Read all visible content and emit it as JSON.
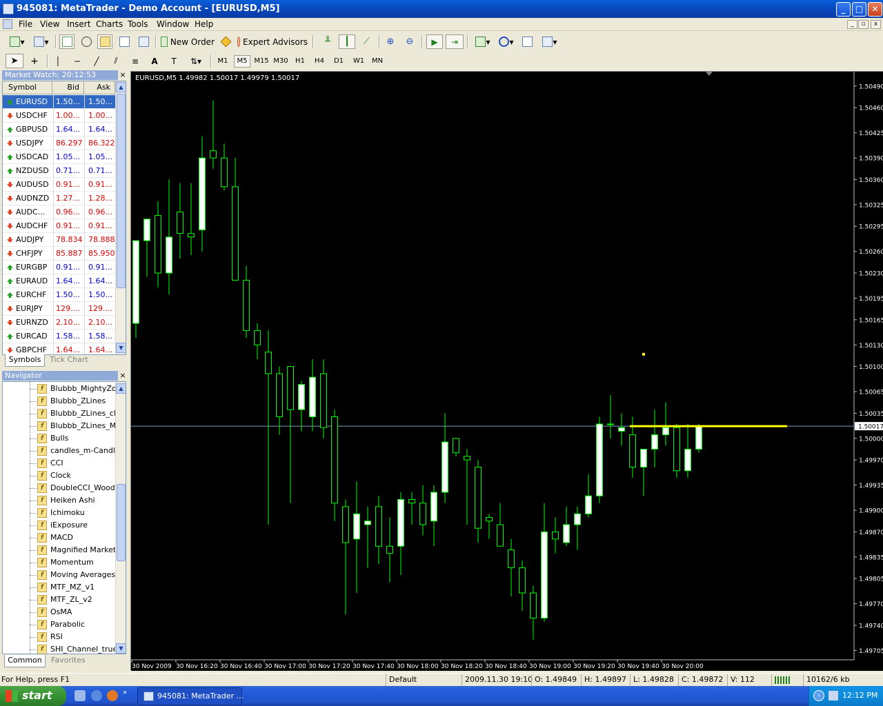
{
  "window": {
    "title": "945081: MetaTrader - Demo Account - [EURUSD,M5]"
  },
  "menu": [
    "File",
    "View",
    "Insert",
    "Charts",
    "Tools",
    "Window",
    "Help"
  ],
  "toolbar": {
    "new_order": "New Order",
    "expert_advisors": "Expert Advisors"
  },
  "timeframes": [
    "M1",
    "M5",
    "M15",
    "M30",
    "H1",
    "H4",
    "D1",
    "W1",
    "MN"
  ],
  "active_timeframe": "M5",
  "market_watch": {
    "title": "Market Watch: 20:12:53",
    "headers": {
      "symbol": "Symbol",
      "bid": "Bid",
      "ask": "Ask"
    },
    "rows": [
      {
        "symbol": "EURUSD",
        "bid": "1.50...",
        "ask": "1.50...",
        "dir": "up",
        "color": "#0000c8",
        "selected": true
      },
      {
        "symbol": "USDCHF",
        "bid": "1.00...",
        "ask": "1.00...",
        "dir": "down",
        "color": "#d80000"
      },
      {
        "symbol": "GBPUSD",
        "bid": "1.64...",
        "ask": "1.64...",
        "dir": "up",
        "color": "#0000c8"
      },
      {
        "symbol": "USDJPY",
        "bid": "86.297",
        "ask": "86.322",
        "dir": "down",
        "color": "#d80000"
      },
      {
        "symbol": "USDCAD",
        "bid": "1.05...",
        "ask": "1.05...",
        "dir": "up",
        "color": "#0000c8"
      },
      {
        "symbol": "NZDUSD",
        "bid": "0.71...",
        "ask": "0.71...",
        "dir": "up",
        "color": "#0000c8"
      },
      {
        "symbol": "AUDUSD",
        "bid": "0.91...",
        "ask": "0.91...",
        "dir": "down",
        "color": "#d80000"
      },
      {
        "symbol": "AUDNZD",
        "bid": "1.27...",
        "ask": "1.28...",
        "dir": "down",
        "color": "#d80000"
      },
      {
        "symbol": "AUDC...",
        "bid": "0.96...",
        "ask": "0.96...",
        "dir": "down",
        "color": "#d80000"
      },
      {
        "symbol": "AUDCHF",
        "bid": "0.91...",
        "ask": "0.91...",
        "dir": "down",
        "color": "#d80000"
      },
      {
        "symbol": "AUDJPY",
        "bid": "78.834",
        "ask": "78.888",
        "dir": "down",
        "color": "#d80000"
      },
      {
        "symbol": "CHFJPY",
        "bid": "85.887",
        "ask": "85.950",
        "dir": "down",
        "color": "#d80000"
      },
      {
        "symbol": "EURGBP",
        "bid": "0.91...",
        "ask": "0.91...",
        "dir": "up",
        "color": "#0000c8"
      },
      {
        "symbol": "EURAUD",
        "bid": "1.64...",
        "ask": "1.64...",
        "dir": "up",
        "color": "#0000c8"
      },
      {
        "symbol": "EURCHF",
        "bid": "1.50...",
        "ask": "1.50...",
        "dir": "up",
        "color": "#0000c8"
      },
      {
        "symbol": "EURJPY",
        "bid": "129....",
        "ask": "129....",
        "dir": "down",
        "color": "#d80000"
      },
      {
        "symbol": "EURNZD",
        "bid": "2.10...",
        "ask": "2.10...",
        "dir": "down",
        "color": "#d80000"
      },
      {
        "symbol": "EURCAD",
        "bid": "1.58...",
        "ask": "1.58...",
        "dir": "up",
        "color": "#0000c8"
      },
      {
        "symbol": "GBPCHF",
        "bid": "1.64...",
        "ask": "1.64...",
        "dir": "down",
        "color": "#d80000"
      }
    ],
    "tabs": [
      "Symbols",
      "Tick Chart"
    ]
  },
  "navigator": {
    "title": "Navigator",
    "items": [
      "Blubbb_MightyZone",
      "Blubbb_ZLines",
      "Blubbb_ZLines_close",
      "Blubbb_ZLines_MZ_",
      "Bulls",
      "candles_m-Candles_",
      "CCI",
      "Clock",
      "DoubleCCI_Woodie",
      "Heiken Ashi",
      "Ichimoku",
      "iExposure",
      "MACD",
      "Magnified Market Pr",
      "Momentum",
      "Moving Averages",
      "MTF_MZ_v1",
      "MTF_ZL_v2",
      "OsMA",
      "Parabolic",
      "RSI",
      "SHI_Channel_true"
    ],
    "tabs": [
      "Common",
      "Favorites"
    ]
  },
  "chart_data": {
    "type": "candlestick",
    "header": "EURUSD,M5  1.49982 1.50017 1.49979 1.50017",
    "ylim": [
      1.49692,
      1.5051
    ],
    "y_ticks": [
      "1.50490",
      "1.50460",
      "1.50425",
      "1.50390",
      "1.50360",
      "1.50325",
      "1.50295",
      "1.50260",
      "1.50230",
      "1.50195",
      "1.50165",
      "1.50130",
      "1.50100",
      "1.50065",
      "1.50035",
      "1.50000",
      "1.49970",
      "1.49935",
      "1.49900",
      "1.49870",
      "1.49835",
      "1.49805",
      "1.49770",
      "1.49740",
      "1.49705"
    ],
    "current_price": "1.50017",
    "x_labels": [
      "30 Nov 2009",
      "30 Nov 16:20",
      "30 Nov 16:40",
      "30 Nov 17:00",
      "30 Nov 17:20",
      "30 Nov 17:40",
      "30 Nov 18:00",
      "30 Nov 18:20",
      "30 Nov 18:40",
      "30 Nov 19:00",
      "30 Nov 19:20",
      "30 Nov 19:40",
      "30 Nov 20:00"
    ],
    "bar_seconds": 300,
    "colors": {
      "background": "#000000",
      "wick": "#00FF00",
      "bull": "#FFFFFF",
      "bear": "#000000",
      "grid": "#808080",
      "bid_line": "#7F9FBF",
      "level": "#FFFF00"
    },
    "candles": [
      [
        1.5016,
        1.50275,
        1.5014,
        1.50275
      ],
      [
        1.50275,
        1.50305,
        1.50225,
        1.50305
      ],
      [
        1.5031,
        1.5033,
        1.5021,
        1.5023
      ],
      [
        1.5023,
        1.5036,
        1.502,
        1.5028
      ],
      [
        1.50315,
        1.50355,
        1.5025,
        1.50285
      ],
      [
        1.50285,
        1.50355,
        1.50255,
        1.5028
      ],
      [
        1.5029,
        1.5042,
        1.5026,
        1.5039
      ],
      [
        1.504,
        1.5047,
        1.50375,
        1.5039
      ],
      [
        1.5039,
        1.5041,
        1.50345,
        1.5035
      ],
      [
        1.5035,
        1.5039,
        1.5022,
        1.5022
      ],
      [
        1.5022,
        1.5024,
        1.5014,
        1.5015
      ],
      [
        1.5015,
        1.5016,
        1.5011,
        1.5013
      ],
      [
        1.5012,
        1.5015,
        1.4988,
        1.5009
      ],
      [
        1.5009,
        1.501,
        1.50005,
        1.5003
      ],
      [
        1.501,
        1.501,
        1.4991,
        1.5004
      ],
      [
        1.5004,
        1.5008,
        1.5001,
        1.50075
      ],
      [
        1.5003,
        1.5011,
        1.5001,
        1.50085
      ],
      [
        1.5009,
        1.5011,
        1.5,
        1.50015
      ],
      [
        1.5003,
        1.5004,
        1.49885,
        1.4991
      ],
      [
        1.49905,
        1.49915,
        1.49755,
        1.49855
      ],
      [
        1.4986,
        1.4994,
        1.49785,
        1.49895
      ],
      [
        1.4988,
        1.49905,
        1.4982,
        1.49885
      ],
      [
        1.49905,
        1.4992,
        1.49825,
        1.4985
      ],
      [
        1.4985,
        1.4989,
        1.498,
        1.4984
      ],
      [
        1.4985,
        1.49925,
        1.4981,
        1.49915
      ],
      [
        1.49915,
        1.49925,
        1.4988,
        1.4991
      ],
      [
        1.4991,
        1.49935,
        1.49865,
        1.4988
      ],
      [
        1.49885,
        1.49935,
        1.4985,
        1.49925
      ],
      [
        1.49925,
        1.50035,
        1.4991,
        1.49995
      ],
      [
        1.5,
        1.5,
        1.49975,
        1.4998
      ],
      [
        1.49975,
        1.49985,
        1.4988,
        1.4997
      ],
      [
        1.4996,
        1.4997,
        1.49855,
        1.49875
      ],
      [
        1.4989,
        1.49895,
        1.4986,
        1.49885
      ],
      [
        1.4988,
        1.4991,
        1.4986,
        1.4985
      ],
      [
        1.49845,
        1.4986,
        1.4978,
        1.4982
      ],
      [
        1.4982,
        1.4983,
        1.4976,
        1.49785
      ],
      [
        1.49785,
        1.49795,
        1.4972,
        1.4975
      ],
      [
        1.4975,
        1.4991,
        1.49745,
        1.4987
      ],
      [
        1.4987,
        1.4989,
        1.4984,
        1.4986
      ],
      [
        1.49855,
        1.49905,
        1.4985,
        1.4988
      ],
      [
        1.4988,
        1.49905,
        1.49845,
        1.49895
      ],
      [
        1.49895,
        1.4995,
        1.4989,
        1.4992
      ],
      [
        1.4992,
        1.5003,
        1.4991,
        1.5002
      ],
      [
        1.5002,
        1.5006,
        1.5,
        1.5002
      ],
      [
        1.5001,
        1.50035,
        1.4999,
        1.50015
      ],
      [
        1.50005,
        1.5003,
        1.49945,
        1.4996
      ],
      [
        1.4996,
        1.49985,
        1.4992,
        1.49985
      ],
      [
        1.49985,
        1.5004,
        1.4996,
        1.50005
      ],
      [
        1.50005,
        1.5005,
        1.4999,
        1.50015
      ],
      [
        1.50015,
        1.5002,
        1.49945,
        1.49955
      ],
      [
        1.49955,
        1.5002,
        1.49945,
        1.49985
      ],
      [
        1.49985,
        1.5002,
        1.4998,
        1.50017
      ]
    ],
    "levels": [
      {
        "price": 1.50017,
        "from": 45,
        "to": 59,
        "label": "yellow line"
      },
      {
        "price": 1.50117,
        "at": 46,
        "label": "yellow dot"
      }
    ]
  },
  "status": {
    "help": "For Help, press F1",
    "profile": "Default",
    "datetime": "2009.11.30 19:10",
    "open": "O: 1.49849",
    "high": "H: 1.49897",
    "low": "L: 1.49828",
    "close": "C: 1.49872",
    "volume": "V: 112",
    "traffic": "10162/6 kb"
  },
  "taskbar": {
    "start": "start",
    "task": "945081: MetaTrader ...",
    "clock": "12:12 PM"
  }
}
